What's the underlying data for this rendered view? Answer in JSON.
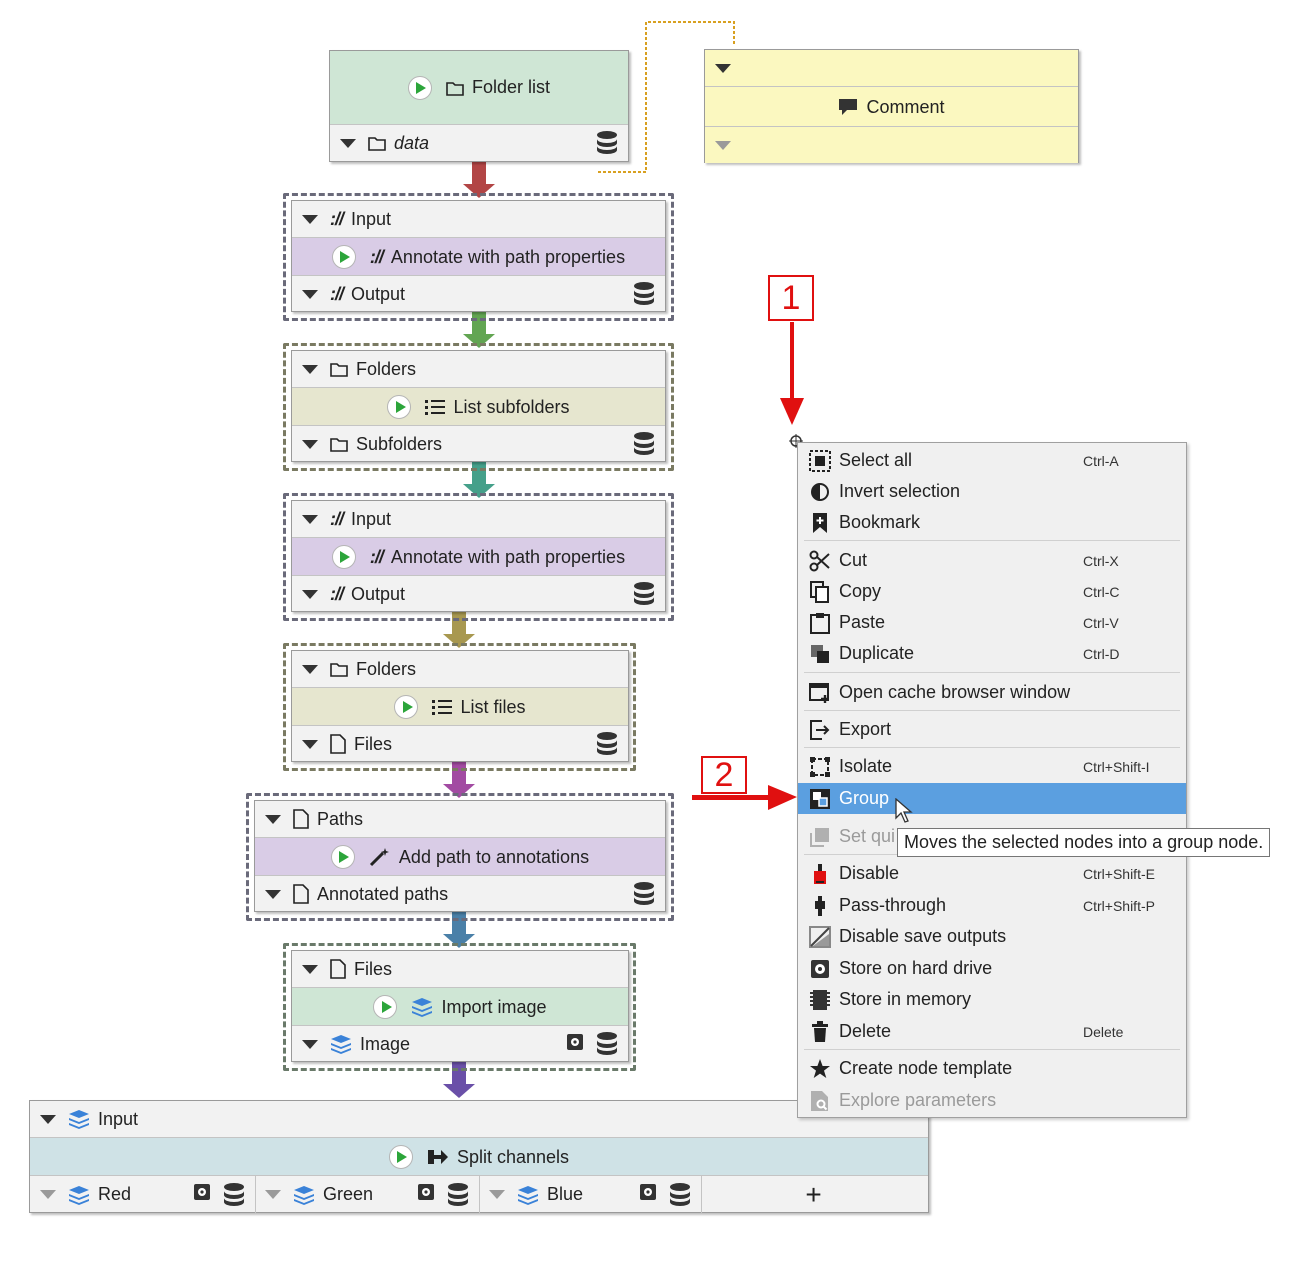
{
  "nodes": {
    "folder_list": {
      "title": "Folder list",
      "output": "data"
    },
    "annotate1": {
      "input": "Input",
      "title": "Annotate with path properties",
      "output": "Output",
      "protocol": "://"
    },
    "list_subfolders": {
      "input": "Folders",
      "title": "List subfolders",
      "output": "Subfolders"
    },
    "annotate2": {
      "input": "Input",
      "title": "Annotate with path properties",
      "output": "Output",
      "protocol": "://"
    },
    "list_files": {
      "input": "Folders",
      "title": "List files",
      "output": "Files"
    },
    "add_path": {
      "input": "Paths",
      "title": "Add path to annotations",
      "output": "Annotated paths"
    },
    "import_image": {
      "input": "Files",
      "title": "Import image",
      "output": "Image"
    },
    "split_channels": {
      "input": "Input",
      "title": "Split channels",
      "outputs": [
        "Red",
        "Green",
        "Blue"
      ],
      "add_label": "+"
    }
  },
  "comment": {
    "title": "Comment"
  },
  "context_menu": {
    "items": [
      {
        "label": "Select all",
        "shortcut": "Ctrl-A",
        "icon": "select-all-icon"
      },
      {
        "label": "Invert selection",
        "shortcut": "",
        "icon": "invert-selection-icon"
      },
      {
        "label": "Bookmark",
        "shortcut": "",
        "icon": "bookmark-icon"
      },
      {
        "label": "Cut",
        "shortcut": "Ctrl-X",
        "icon": "scissors-icon"
      },
      {
        "label": "Copy",
        "shortcut": "Ctrl-C",
        "icon": "copy-icon"
      },
      {
        "label": "Paste",
        "shortcut": "Ctrl-V",
        "icon": "paste-icon"
      },
      {
        "label": "Duplicate",
        "shortcut": "Ctrl-D",
        "icon": "duplicate-icon"
      },
      {
        "label": "Open cache browser window",
        "shortcut": "",
        "icon": "cache-browser-icon"
      },
      {
        "label": "Export",
        "shortcut": "",
        "icon": "export-icon"
      },
      {
        "label": "Isolate",
        "shortcut": "Ctrl+Shift-I",
        "icon": "isolate-icon"
      },
      {
        "label": "Group",
        "shortcut": "",
        "icon": "group-icon"
      },
      {
        "label": "Set qui",
        "shortcut": "",
        "icon": "quick-access-icon"
      },
      {
        "label": "Disable",
        "shortcut": "Ctrl+Shift-E",
        "icon": "disable-icon"
      },
      {
        "label": "Pass-through",
        "shortcut": "Ctrl+Shift-P",
        "icon": "pass-through-icon"
      },
      {
        "label": "Disable save outputs",
        "shortcut": "",
        "icon": "disable-save-icon"
      },
      {
        "label": "Store on hard drive",
        "shortcut": "",
        "icon": "hard-drive-icon"
      },
      {
        "label": "Store in memory",
        "shortcut": "",
        "icon": "memory-icon"
      },
      {
        "label": "Delete",
        "shortcut": "Delete",
        "icon": "trash-icon"
      },
      {
        "label": "Create node template",
        "shortcut": "",
        "icon": "star-icon"
      },
      {
        "label": "Explore parameters",
        "shortcut": "",
        "icon": "explore-parameters-icon"
      }
    ]
  },
  "tooltip": "Moves the selected nodes into a group node.",
  "annotations": {
    "badge1": "1",
    "badge2": "2"
  },
  "colors": {
    "selection": "#5b9fe0",
    "annotation_red": "#e01010",
    "comment_bg": "#fbf8c0"
  }
}
